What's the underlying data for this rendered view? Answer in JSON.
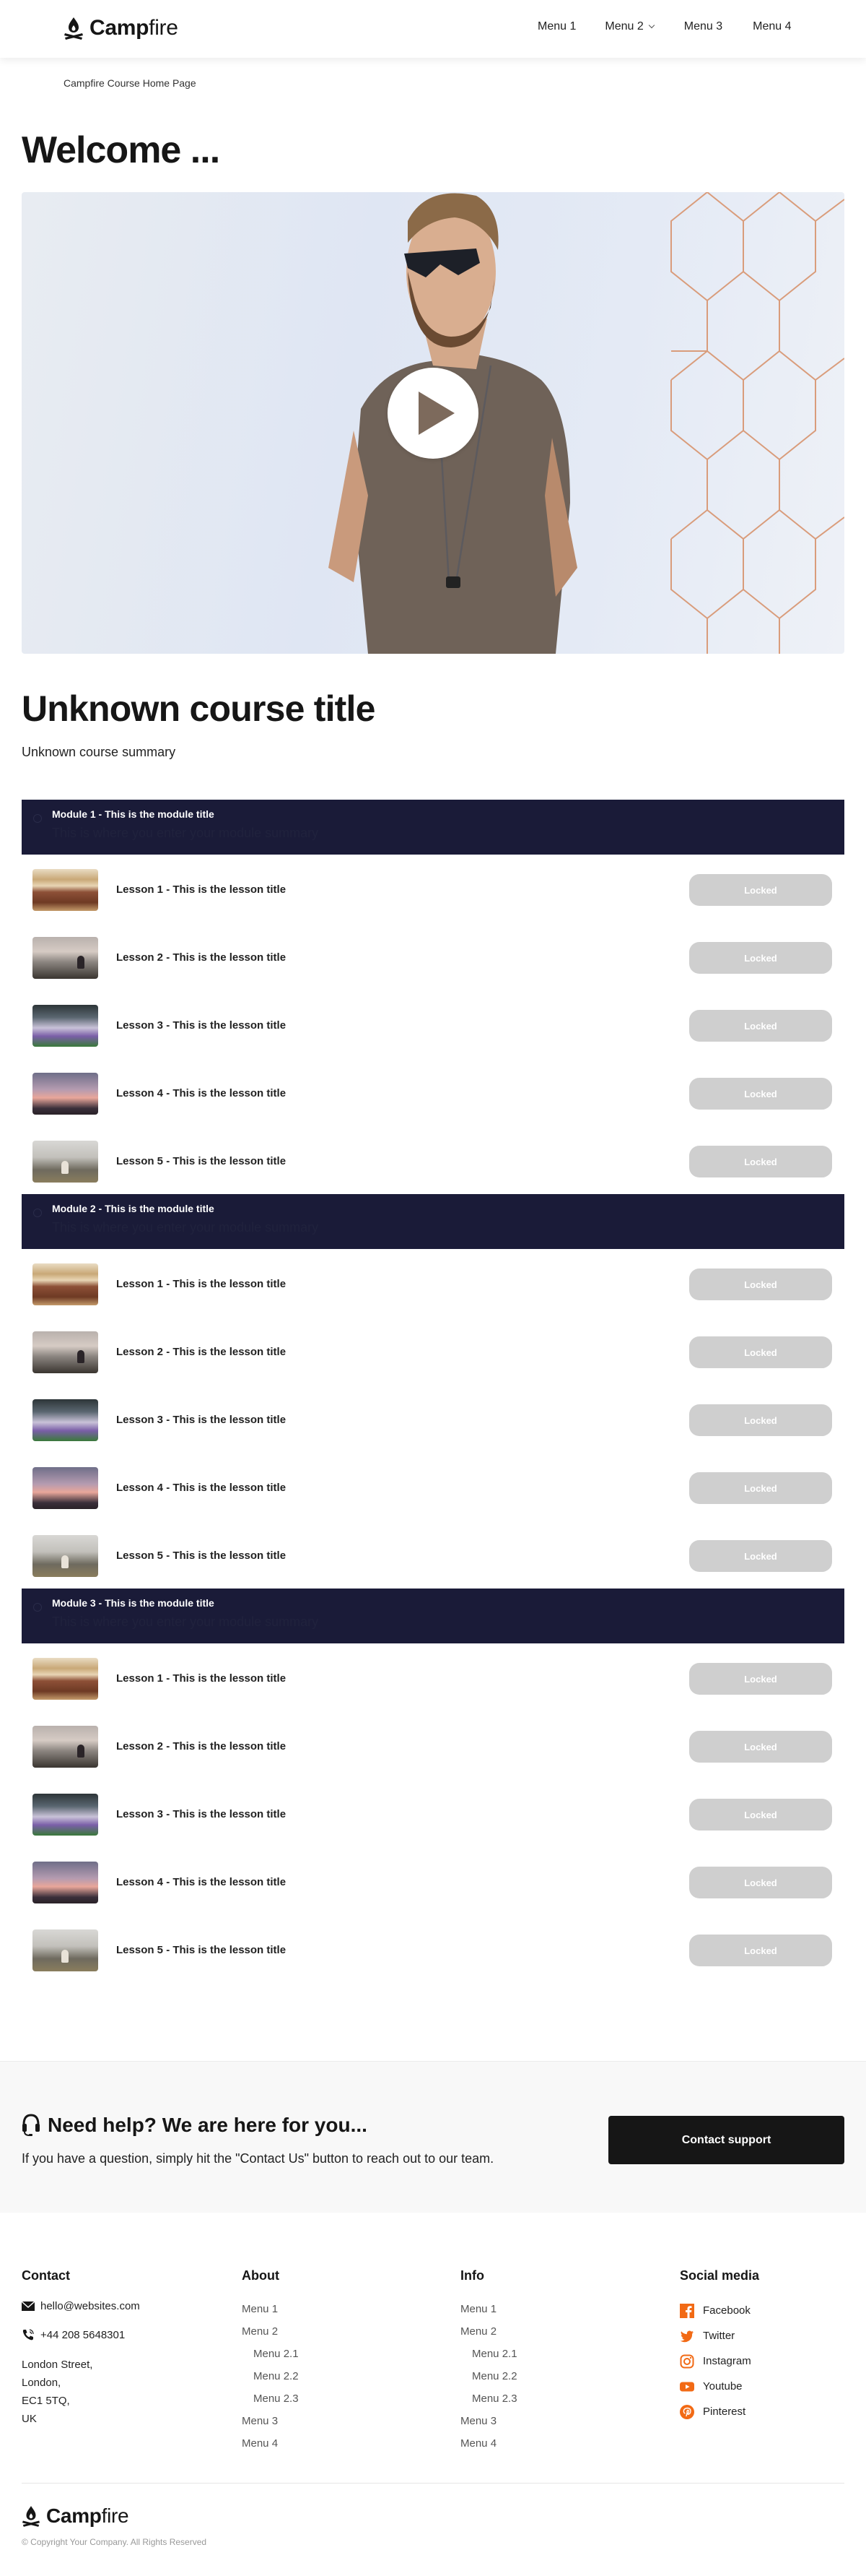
{
  "header": {
    "logo": {
      "bold": "Camp",
      "light": "fire",
      "icon": "campfire-icon"
    },
    "nav": [
      {
        "label": "Menu 1",
        "has_dropdown": false
      },
      {
        "label": "Menu 2",
        "has_dropdown": true
      },
      {
        "label": "Menu 3",
        "has_dropdown": false
      },
      {
        "label": "Menu 4",
        "has_dropdown": false
      }
    ]
  },
  "breadcrumb": "Campfire Course Home Page",
  "welcome": "Welcome ...",
  "hero": {
    "video": "play-icon"
  },
  "course": {
    "title": "Unknown course title",
    "summary": "Unknown course summary"
  },
  "colors": {
    "module_header_bg": "#1a1b38",
    "locked_button_bg": "#cfcfcf",
    "social_icon": "#f26a15",
    "contact_button_bg": "#161616"
  },
  "modules": [
    {
      "title": "Module 1 - This is the module title",
      "summary": "This is where you enter your module summary",
      "lessons": [
        {
          "title": "Lesson 1 - This is the lesson title",
          "status": "Locked"
        },
        {
          "title": "Lesson 2 - This is the lesson title",
          "status": "Locked"
        },
        {
          "title": "Lesson 3 - This is the lesson title",
          "status": "Locked"
        },
        {
          "title": "Lesson 4 - This is the lesson title",
          "status": "Locked"
        },
        {
          "title": "Lesson 5 - This is the lesson title",
          "status": "Locked"
        }
      ]
    },
    {
      "title": "Module 2 - This is the module title",
      "summary": "This is where you enter your module summary",
      "lessons": [
        {
          "title": "Lesson 1 - This is the lesson title",
          "status": "Locked"
        },
        {
          "title": "Lesson 2 - This is the lesson title",
          "status": "Locked"
        },
        {
          "title": "Lesson 3 - This is the lesson title",
          "status": "Locked"
        },
        {
          "title": "Lesson 4 - This is the lesson title",
          "status": "Locked"
        },
        {
          "title": "Lesson 5 - This is the lesson title",
          "status": "Locked"
        }
      ]
    },
    {
      "title": "Module 3 - This is the module title",
      "summary": "This is where you enter your module summary",
      "lessons": [
        {
          "title": "Lesson 1 - This is the lesson title",
          "status": "Locked"
        },
        {
          "title": "Lesson 2 - This is the lesson title",
          "status": "Locked"
        },
        {
          "title": "Lesson 3 - This is the lesson title",
          "status": "Locked"
        },
        {
          "title": "Lesson 4 - This is the lesson title",
          "status": "Locked"
        },
        {
          "title": "Lesson 5 - This is the lesson title",
          "status": "Locked"
        }
      ]
    }
  ],
  "help": {
    "title": "Need help? We are here for you...",
    "text": "If you have a question, simply hit the \"Contact Us\" button to reach out to our team.",
    "button": "Contact support"
  },
  "footer": {
    "contact": {
      "heading": "Contact",
      "email": "hello@websites.com",
      "phone": "+44 208 5648301",
      "address": [
        "London Street,",
        "London,",
        "EC1 5TQ,",
        "UK"
      ]
    },
    "about": {
      "heading": "About",
      "links": [
        {
          "label": "Menu 1",
          "sub": false
        },
        {
          "label": "Menu 2",
          "sub": false
        },
        {
          "label": "Menu 2.1",
          "sub": true
        },
        {
          "label": "Menu 2.2",
          "sub": true
        },
        {
          "label": "Menu 2.3",
          "sub": true
        },
        {
          "label": "Menu 3",
          "sub": false
        },
        {
          "label": "Menu 4",
          "sub": false
        }
      ]
    },
    "info": {
      "heading": "Info",
      "links": [
        {
          "label": "Menu 1",
          "sub": false
        },
        {
          "label": "Menu 2",
          "sub": false
        },
        {
          "label": "Menu 2.1",
          "sub": true
        },
        {
          "label": "Menu 2.2",
          "sub": true
        },
        {
          "label": "Menu 2.3",
          "sub": true
        },
        {
          "label": "Menu 3",
          "sub": false
        },
        {
          "label": "Menu 4",
          "sub": false
        }
      ]
    },
    "social": {
      "heading": "Social media",
      "links": [
        {
          "label": "Facebook",
          "icon": "facebook-icon"
        },
        {
          "label": "Twitter",
          "icon": "twitter-icon"
        },
        {
          "label": "Instagram",
          "icon": "instagram-icon"
        },
        {
          "label": "Youtube",
          "icon": "youtube-icon"
        },
        {
          "label": "Pinterest",
          "icon": "pinterest-icon"
        }
      ]
    },
    "logo": {
      "bold": "Camp",
      "light": "fire"
    },
    "copyright": "© Copyright Your Company.  All Rights Reserved"
  }
}
